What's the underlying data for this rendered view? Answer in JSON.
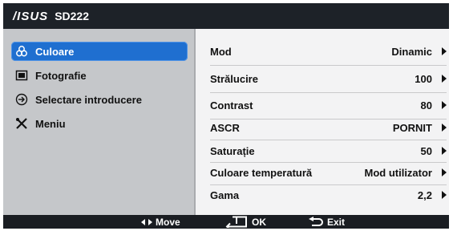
{
  "title": {
    "brand": "/ISUS",
    "model": "SD222"
  },
  "sidebar": {
    "items": [
      {
        "label": "Culoare",
        "icon": "palette-icon",
        "active": true
      },
      {
        "label": "Fotografie",
        "icon": "photo-icon",
        "active": false
      },
      {
        "label": "Selectare introducere",
        "icon": "input-icon",
        "active": false
      },
      {
        "label": "Meniu",
        "icon": "tools-icon",
        "active": false
      }
    ]
  },
  "settings": [
    {
      "label": "Mod",
      "value": "Dinamic"
    },
    {
      "label": "Strălucire",
      "value": "100"
    },
    {
      "label": "Contrast",
      "value": "80"
    },
    {
      "label": "ASCR",
      "value": "PORNIT"
    },
    {
      "label": "Saturație",
      "value": "50"
    },
    {
      "label": "Culoare temperatură",
      "value": "Mod utilizator"
    },
    {
      "label": "Gama",
      "value": "2,2"
    }
  ],
  "footer": {
    "move": "Move",
    "ok": "OK",
    "exit": "Exit"
  },
  "colors": {
    "accent": "#1f6fd0",
    "frame": "#20242a",
    "sidebar": "#c5c7ca",
    "content": "#f3f3f4"
  }
}
